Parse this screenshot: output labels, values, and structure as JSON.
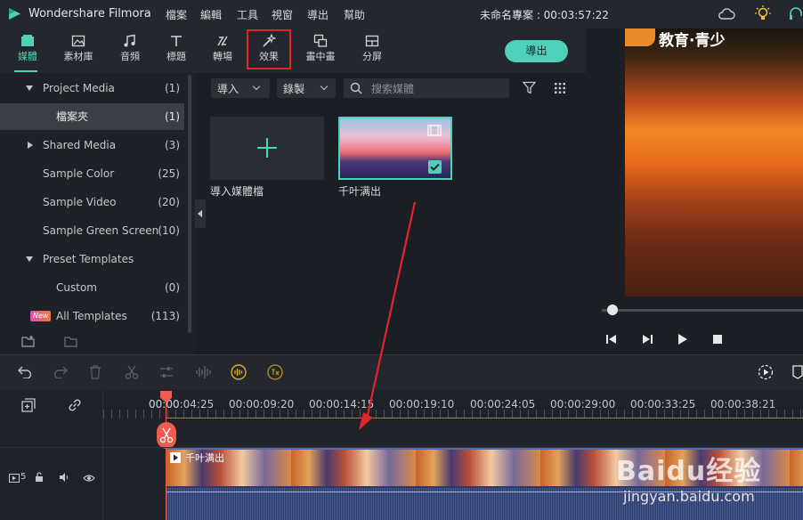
{
  "app": {
    "title": "Wondershare Filmora",
    "project": "未命名專案 : 00:03:57:22"
  },
  "menu": [
    "檔案",
    "編輯",
    "工具",
    "視窗",
    "導出",
    "幫助"
  ],
  "toolbar": {
    "tabs": [
      "媒體",
      "素材庫",
      "音頻",
      "標題",
      "轉場",
      "效果",
      "畫中畫",
      "分屏"
    ],
    "export_label": "導出"
  },
  "sidebar": {
    "items": [
      {
        "label": "Project Media",
        "count": "(1)"
      },
      {
        "label": "檔案夾",
        "count": "(1)"
      },
      {
        "label": "Shared Media",
        "count": "(3)"
      },
      {
        "label": "Sample Color",
        "count": "(25)"
      },
      {
        "label": "Sample Video",
        "count": "(20)"
      },
      {
        "label": "Sample Green Screen",
        "count": "(10)"
      },
      {
        "label": "Preset Templates",
        "count": ""
      },
      {
        "label": "Custom",
        "count": "(0)"
      },
      {
        "label": "All Templates",
        "count": "(113)"
      }
    ],
    "new_badge": "New"
  },
  "media": {
    "import_dropdown": "導入",
    "record_dropdown": "錄製",
    "search_placeholder": "搜索媒體",
    "import_tile_label": "導入媒體檔",
    "clip_label": "千叶满出"
  },
  "preview": {
    "overlay_text": "教育·青少"
  },
  "timeline": {
    "ruler": [
      "00:00:04:25",
      "00:00:09:20",
      "00:00:14:15",
      "00:00:19:10",
      "00:00:24:05",
      "00:00:29:00",
      "00:00:33:25",
      "00:00:38:21"
    ],
    "ruler_start": "00:00",
    "track_number": "5",
    "clip_title": "千叶满出"
  },
  "watermark": {
    "brand": "Baidu经验",
    "url": "jingyan.baidu.com"
  },
  "colors": {
    "accent": "#4fd1b9",
    "playhead": "#f05a4f",
    "annotation": "#e0262b"
  }
}
